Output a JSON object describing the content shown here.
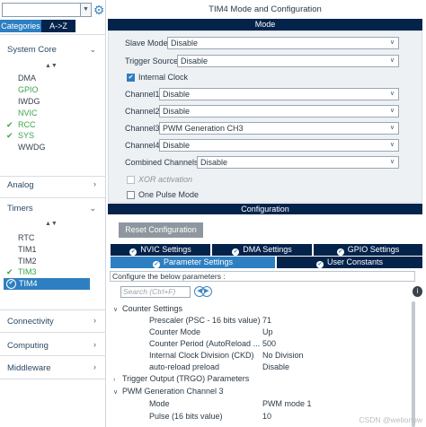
{
  "sidebar": {
    "settings_icon": "gear-icon",
    "tabs": [
      "Categories",
      "A->Z"
    ],
    "categories": {
      "system_core": "System Core",
      "analog": "Analog",
      "timers": "Timers",
      "connectivity": "Connectivity",
      "computing": "Computing",
      "middleware": "Middleware"
    },
    "system_core_items": [
      "DMA",
      "GPIO",
      "IWDG",
      "NVIC",
      "RCC",
      "SYS",
      "WWDG"
    ],
    "timer_items": [
      "RTC",
      "TIM1",
      "TIM2",
      "TIM3",
      "TIM4"
    ]
  },
  "main": {
    "title": "TIM4 Mode and Configuration",
    "mode_header": "Mode",
    "config_header": "Configuration",
    "slave_mode": {
      "label": "Slave Mode",
      "value": "Disable"
    },
    "trigger_source": {
      "label": "Trigger Source",
      "value": "Disable"
    },
    "internal_clock": {
      "label": "Internal Clock",
      "checked": true
    },
    "channel1": {
      "label": "Channel1",
      "value": "Disable"
    },
    "channel2": {
      "label": "Channel2",
      "value": "Disable"
    },
    "channel3": {
      "label": "Channel3",
      "value": "PWM Generation CH3"
    },
    "channel4": {
      "label": "Channel4",
      "value": "Disable"
    },
    "combined_channels": {
      "label": "Combined Channels",
      "value": "Disable"
    },
    "xor_activation": {
      "label": "XOR activation",
      "checked": false
    },
    "one_pulse_mode": {
      "label": "One Pulse Mode",
      "checked": false
    },
    "reset_button": "Reset Configuration",
    "config_tabs": {
      "nvic": "NVIC Settings",
      "dma": "DMA Settings",
      "gpio": "GPIO Settings",
      "params": "Parameter Settings",
      "user_constants": "User Constants"
    },
    "params_note": "Configure the below parameters :",
    "search_placeholder": "Search (Ctrl+F)",
    "counter_settings": "Counter Settings",
    "trgo_parameters": "Trigger Output (TRGO) Parameters",
    "pwm_channel3": "PWM Generation Channel 3",
    "counter_params": [
      {
        "name": "Prescaler (PSC - 16 bits value)",
        "value": "71"
      },
      {
        "name": "Counter Mode",
        "value": "Up"
      },
      {
        "name": "Counter Period (AutoReload ...",
        "value": "500"
      },
      {
        "name": "Internal Clock Division (CKD)",
        "value": "No Division"
      },
      {
        "name": "auto-reload preload",
        "value": "Disable"
      }
    ],
    "pwm_params": [
      {
        "name": "Mode",
        "value": "PWM mode 1"
      },
      {
        "name": "Pulse (16 bits value)",
        "value": "10"
      }
    ]
  },
  "watermark": "CSDN @wetionow",
  "colors": {
    "accent": "#2d7fc1",
    "navy": "#03234b",
    "green": "#3aa64b"
  }
}
